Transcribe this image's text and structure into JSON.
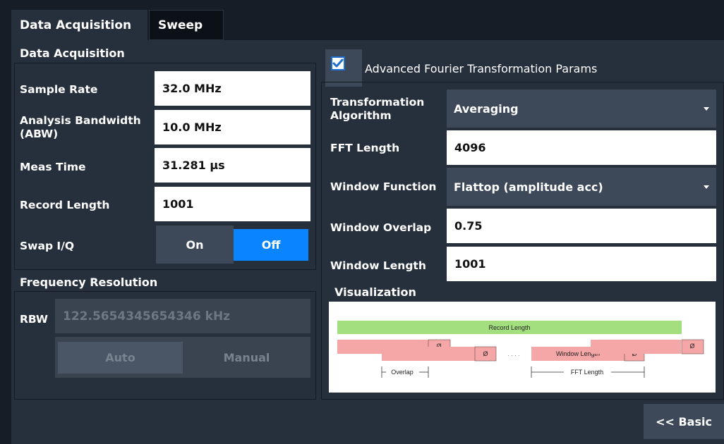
{
  "tabs": [
    {
      "label": "Data Acquisition",
      "active": true
    },
    {
      "label": "Sweep",
      "active": false
    }
  ],
  "data_acquisition": {
    "title": "Data Acquisition",
    "sample_rate": {
      "label": "Sample Rate",
      "value": "32.0 MHz"
    },
    "abw": {
      "label": "Analysis Bandwidth (ABW)",
      "value": "10.0 MHz"
    },
    "meas_time": {
      "label": "Meas Time",
      "value": "31.281 µs"
    },
    "record_length": {
      "label": "Record Length",
      "value": "1001"
    },
    "swap_iq": {
      "label": "Swap I/Q",
      "on_label": "On",
      "off_label": "Off",
      "selected": "Off"
    }
  },
  "frequency_resolution": {
    "title": "Frequency Resolution",
    "rbw_label": "RBW",
    "rbw_value": "122.5654345654346 kHz",
    "auto_label": "Auto",
    "manual_label": "Manual"
  },
  "advanced": {
    "checkbox_label": "Advanced Fourier Transformation Params",
    "checked": true,
    "transformation_algorithm": {
      "label": "Transformation Algorithm",
      "value": "Averaging"
    },
    "fft_length": {
      "label": "FFT Length",
      "value": "4096"
    },
    "window_function": {
      "label": "Window Function",
      "value": "Flattop (amplitude acc)"
    },
    "window_overlap": {
      "label": "Window Overlap",
      "value": "0.75"
    },
    "window_length": {
      "label": "Window Length",
      "value": "1001"
    }
  },
  "visualization": {
    "title": "Visualization",
    "record_length_label": "Record Length",
    "window_length_label": "Window Length",
    "zero_symbol": "Ø",
    "ellipsis": ". . . .",
    "overlap_label": "Overlap",
    "fft_length_label": "FFT Length",
    "colors": {
      "record": "#a3df7f",
      "window": "#f5a6a6"
    }
  },
  "basic_button_label": "<< Basic",
  "colors": {
    "accent": "#0a84ff",
    "panel": "#262f3c",
    "background": "#161d27",
    "control": "#3d4959"
  }
}
